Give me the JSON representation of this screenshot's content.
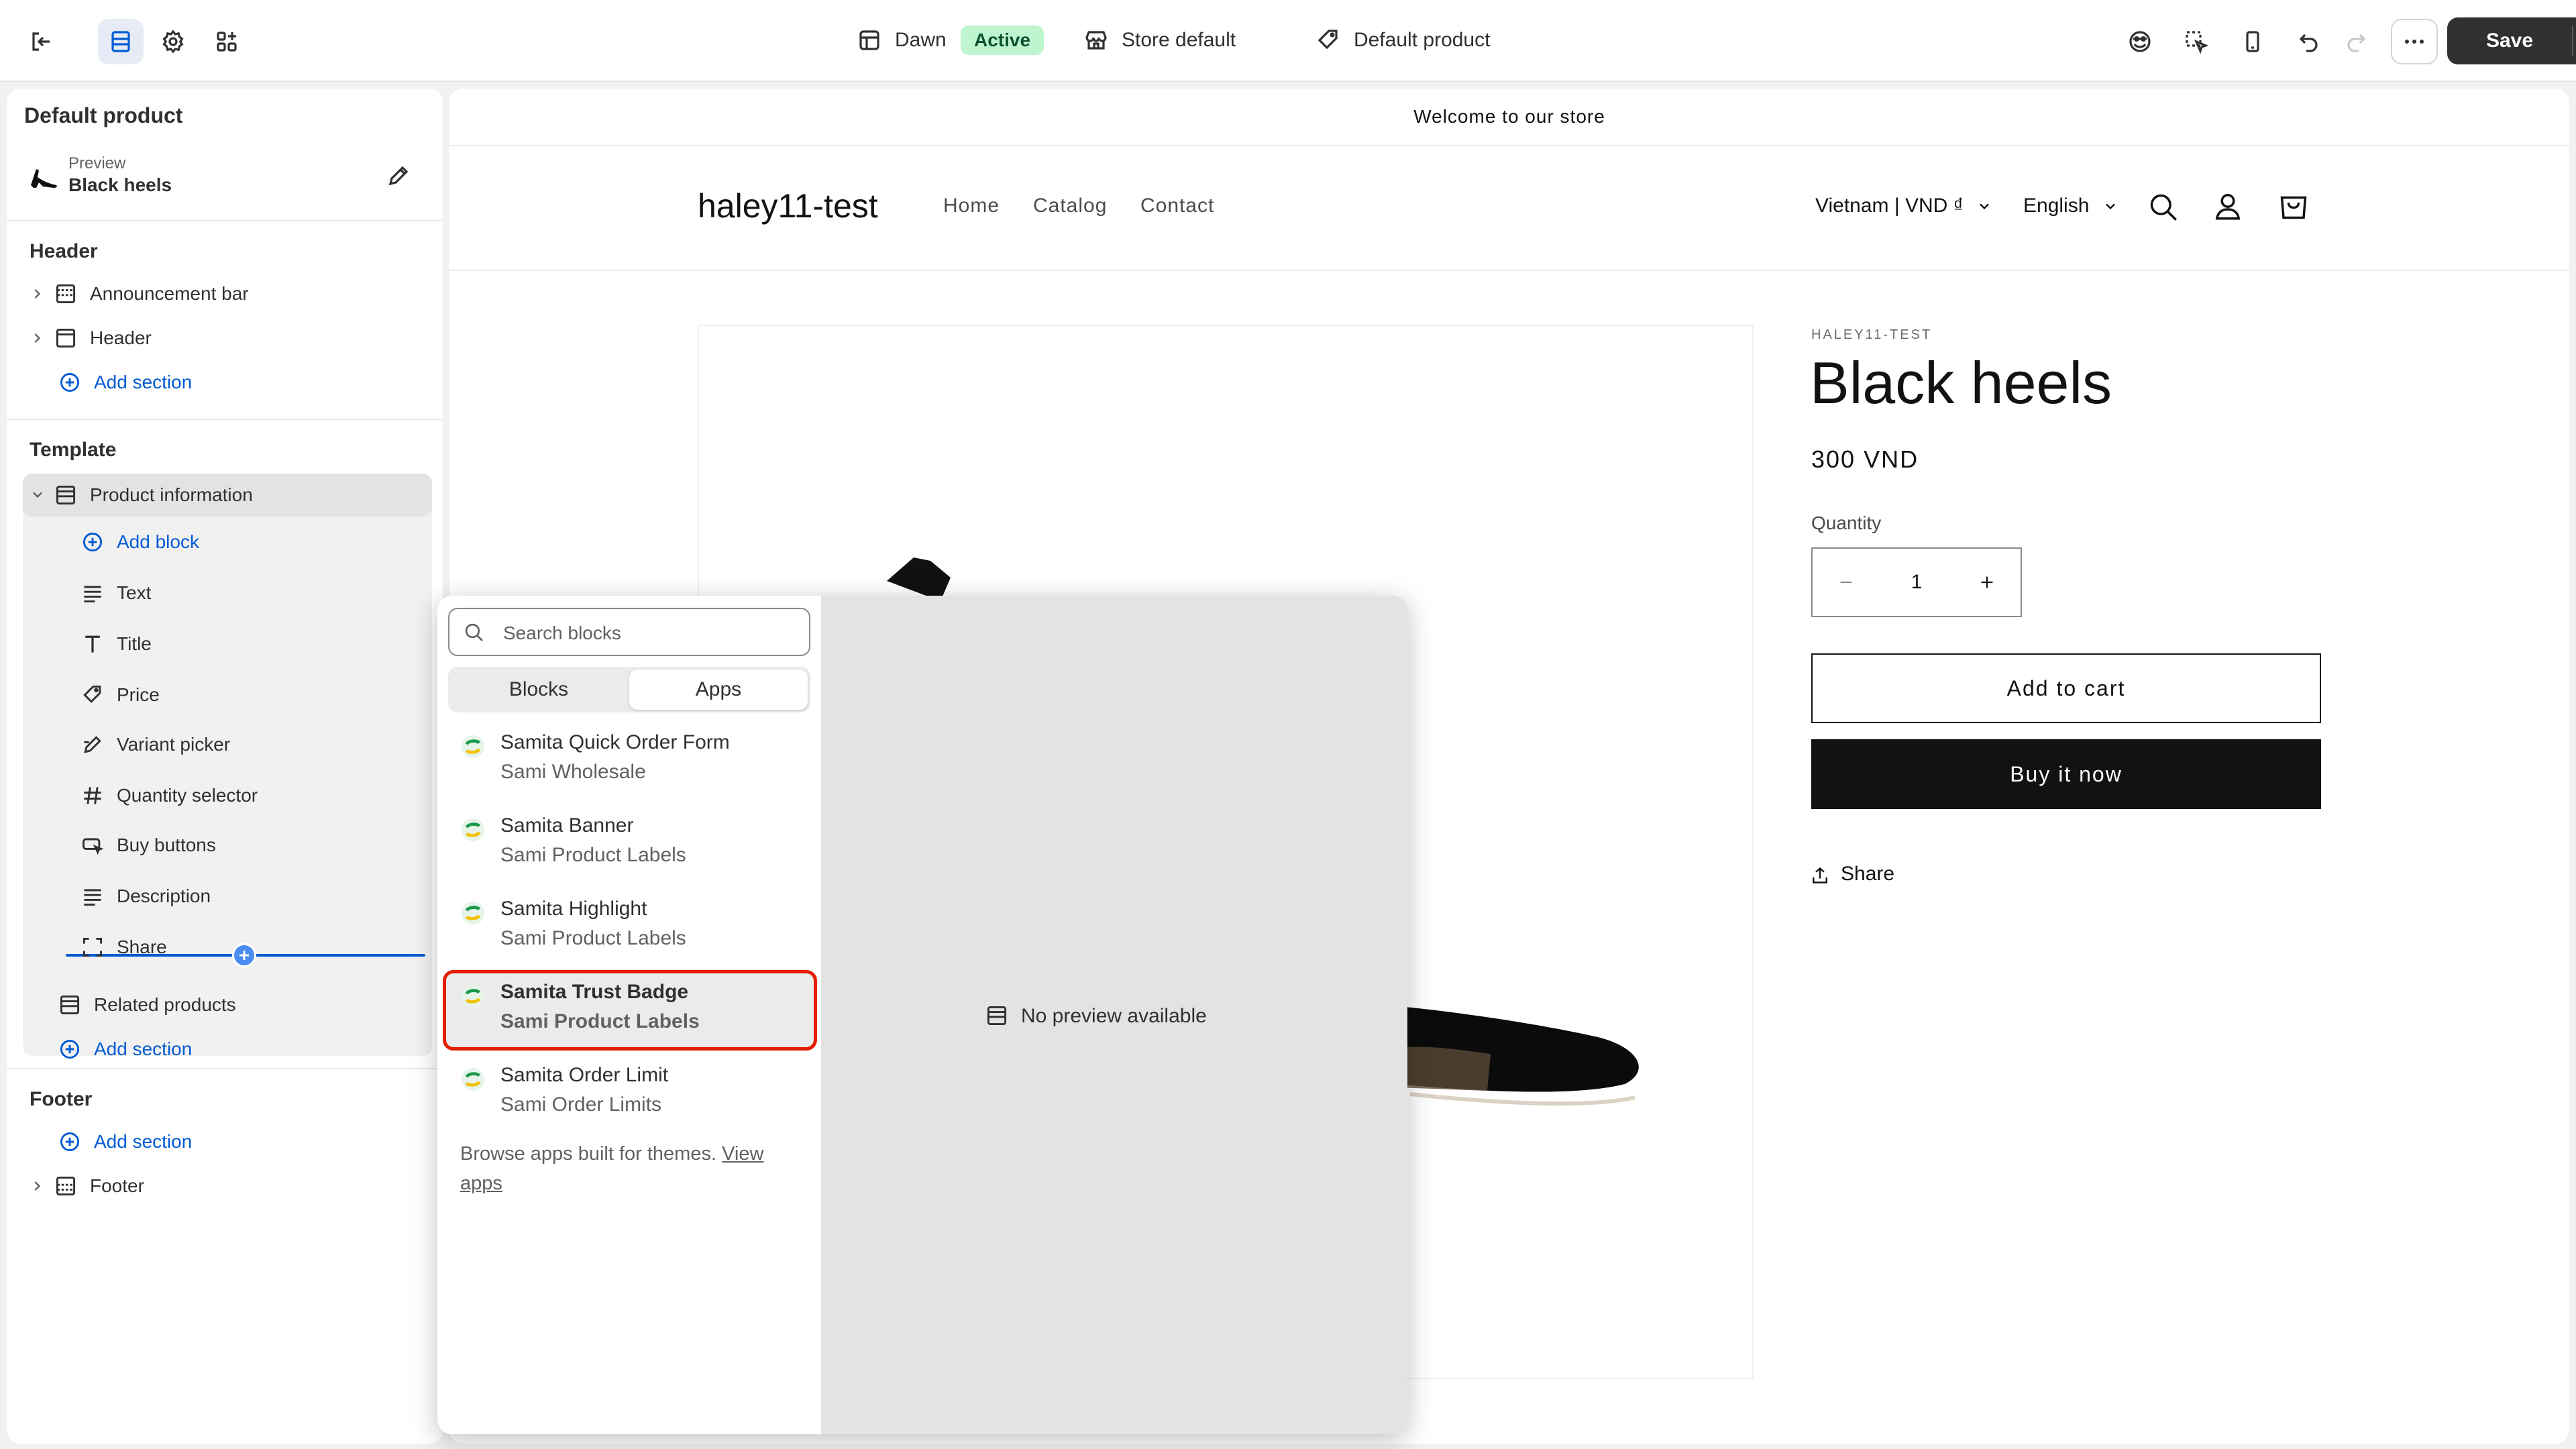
{
  "topbar": {
    "theme_name": "Dawn",
    "theme_status": "Active",
    "store_label": "Store default",
    "template_label": "Default product",
    "save_label": "Save"
  },
  "sidebar": {
    "title": "Default product",
    "preview_label": "Preview",
    "preview_value": "Black heels",
    "header_heading": "Header",
    "header_items": [
      "Announcement bar",
      "Header"
    ],
    "add_section": "Add section",
    "template_heading": "Template",
    "product_information": "Product information",
    "add_block": "Add block",
    "blocks": [
      "Text",
      "Title",
      "Price",
      "Variant picker",
      "Quantity selector",
      "Buy buttons",
      "Description",
      "Share"
    ],
    "related_products": "Related products",
    "footer_heading": "Footer",
    "footer_item": "Footer"
  },
  "popover": {
    "search_placeholder": "Search blocks",
    "tab_blocks": "Blocks",
    "tab_apps": "Apps",
    "apps": [
      {
        "name": "Samita Quick Order Form",
        "vendor": "Sami Wholesale"
      },
      {
        "name": "Samita Banner",
        "vendor": "Sami Product Labels"
      },
      {
        "name": "Samita Highlight",
        "vendor": "Sami Product Labels"
      },
      {
        "name": "Samita Trust Badge",
        "vendor": "Sami Product Labels"
      },
      {
        "name": "Samita Order Limit",
        "vendor": "Sami Order Limits"
      }
    ],
    "browse_text": "Browse apps built for themes.",
    "view_link_1": "View",
    "view_link_2": "apps",
    "no_preview": "No preview available"
  },
  "store": {
    "announcement": "Welcome to our store",
    "logo": "haley11-test",
    "nav": [
      "Home",
      "Catalog",
      "Contact"
    ],
    "country": "Vietnam | VND ₫",
    "language": "English",
    "vendor": "HALEY11-TEST",
    "product_title": "Black heels",
    "price": "300 VND",
    "quantity_label": "Quantity",
    "quantity_value": "1",
    "add_to_cart": "Add to cart",
    "buy_now": "Buy it now",
    "share": "Share"
  },
  "colors": {
    "accent_blue": "#005bd3",
    "active_badge_bg": "#bef5cf",
    "highlight_border": "#e51c00",
    "buy_button_bg": "#121212"
  }
}
